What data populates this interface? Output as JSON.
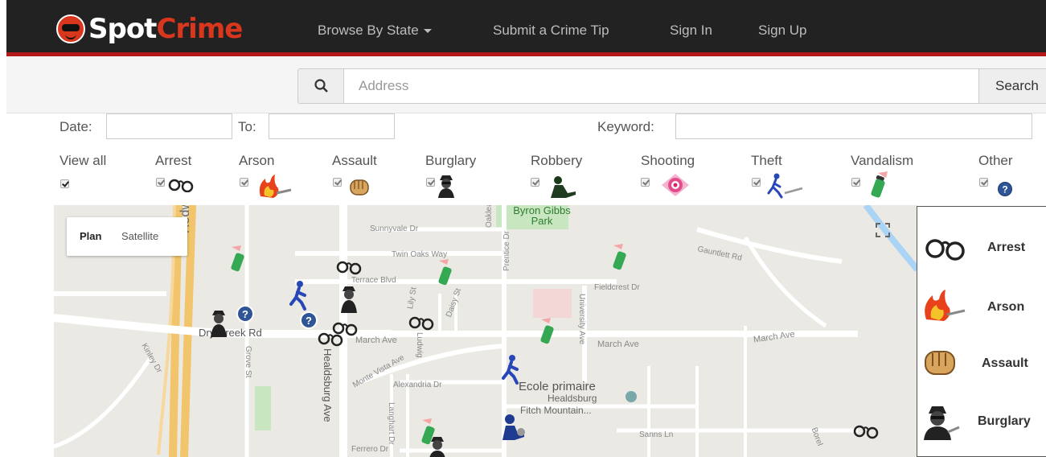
{
  "navbar": {
    "logo_parts": [
      "Sp",
      "ot",
      "Crime"
    ],
    "links": [
      {
        "label": "Browse By State"
      },
      {
        "label": "Submit a Crime Tip"
      },
      {
        "label": "Sign In"
      },
      {
        "label": "Sign Up"
      }
    ]
  },
  "search": {
    "placeholder": "Address",
    "button_label": "Search"
  },
  "filters": {
    "date_label": "Date:",
    "to_label": "To:",
    "keyword_label": "Keyword:",
    "categories": [
      {
        "label": "View all",
        "icon": "checkbox",
        "checked": true
      },
      {
        "label": "Arrest",
        "icon": "handcuffs-icon",
        "checked": true
      },
      {
        "label": "Arson",
        "icon": "fire-icon",
        "checked": true
      },
      {
        "label": "Assault",
        "icon": "fist-icon",
        "checked": true
      },
      {
        "label": "Burglary",
        "icon": "burglar-icon",
        "checked": true
      },
      {
        "label": "Robbery",
        "icon": "robber-icon",
        "checked": true
      },
      {
        "label": "Shooting",
        "icon": "target-icon",
        "checked": true
      },
      {
        "label": "Theft",
        "icon": "running-thief-icon",
        "checked": true
      },
      {
        "label": "Vandalism",
        "icon": "spray-can-icon",
        "checked": true
      },
      {
        "label": "Other",
        "icon": "question-icon",
        "checked": true
      }
    ]
  },
  "map": {
    "toggle": {
      "plan": "Plan",
      "satellite": "Satellite"
    },
    "labels": {
      "redwood": "Redwood Hwy",
      "sunnyvale": "Sunnyvale Dr",
      "twin_oaks": "Twin Oaks Way",
      "terrace": "Terrace Blvd",
      "oakleaf": "Oakleaf Av",
      "prentice": "Prentice Dr",
      "byron_gibbs": "Byron Gibbs Park",
      "gauntlett": "Gauntlett Rd",
      "fieldcrest": "Fieldcrest Dr",
      "university": "University Ave",
      "march1": "March Ave",
      "march2": "March Ave",
      "march3": "March Ave",
      "dry_creek": "Dry Creek Rd",
      "grove": "Grove St",
      "kinley": "Kinley Dr",
      "lily": "Lily St",
      "daisy": "Daisy St",
      "ludwig": "Ludwig",
      "healdsburg": "Healdsburg Ave",
      "monte_vista": "Monte Vista Ave",
      "alexandria": "Alexandria Dr",
      "ecole": "Ecole primaire",
      "ecole2": "Healdsburg",
      "fitch": "Fitch Mountain...",
      "langhart": "Langhart Dr",
      "ferrero": "Ferrero Dr",
      "sanns": "Sanns Ln",
      "borel": "Borel"
    }
  },
  "legend": {
    "items": [
      {
        "label": "Arrest",
        "icon": "handcuffs-icon"
      },
      {
        "label": "Arson",
        "icon": "fire-icon"
      },
      {
        "label": "Assault",
        "icon": "fist-icon"
      },
      {
        "label": "Burglary",
        "icon": "burglar-icon"
      }
    ]
  },
  "colors": {
    "navbar_bg": "#222222",
    "brand_red": "#d9361e",
    "navbar_border": "#b51a1a"
  }
}
